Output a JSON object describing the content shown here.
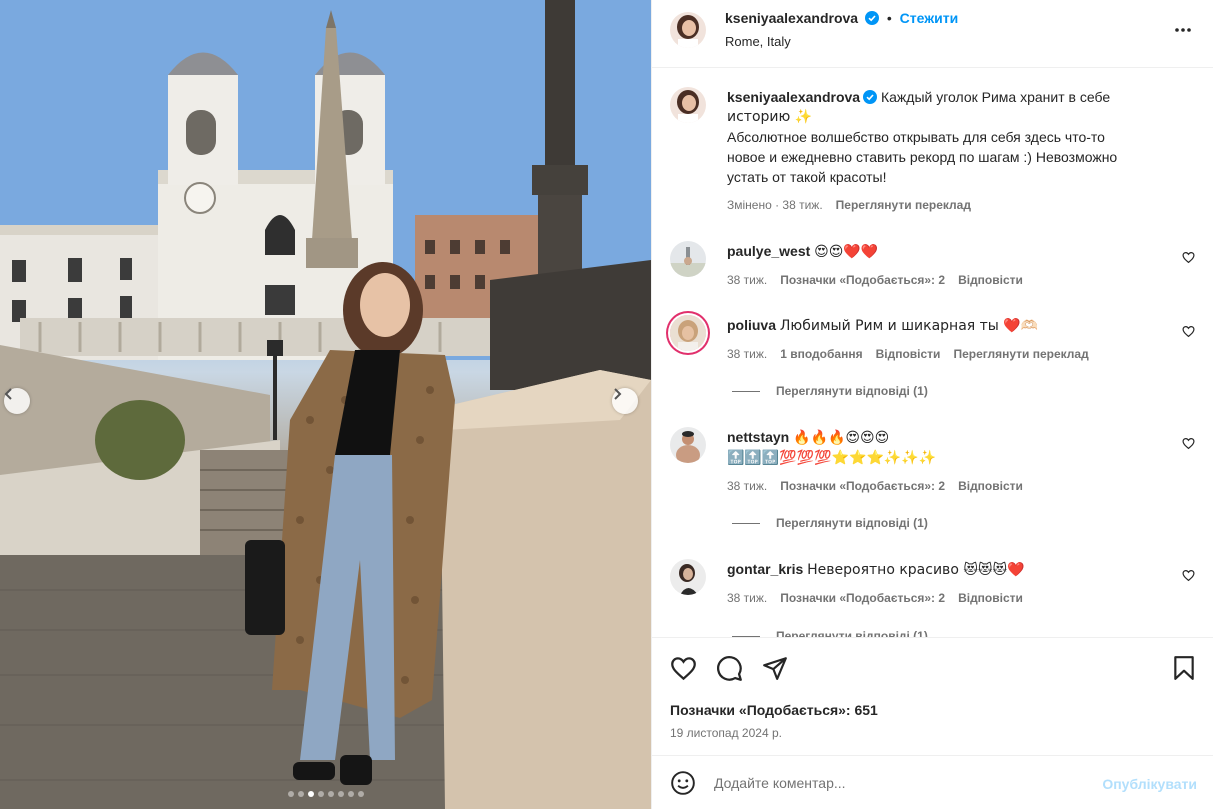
{
  "post": {
    "author": "kseniyaalexandrova",
    "follow_label": "Стежити",
    "location": "Rome, Italy",
    "caption_line1": "Каждый уголок Рима хранит в себе",
    "caption_line2": "историю ✨",
    "caption_line3": "Абсолютное волшебство открывать для себя здесь что-то",
    "caption_line4": "новое и ежедневно ставить рекорд по шагам :) Невозможно",
    "caption_line5": "устать от такой красоты!",
    "caption_edited": "Змінено · 38 тиж.",
    "caption_translate": "Переглянути переклад",
    "likes_text": "Позначки «Подобається»: 651",
    "date": "19 листопад 2024 р.",
    "carousel_count": 8,
    "carousel_active_index": 2
  },
  "comments": [
    {
      "user": "paulye_west",
      "text": "😍😍❤️❤️",
      "age": "38 тиж.",
      "likes": "Позначки «Подобається»: 2",
      "reply": "Відповісти"
    },
    {
      "user": "poliuva",
      "text": "Любимый Рим и шикарная ты ❤️🫶🏻",
      "age": "38 тиж.",
      "likes": "1 вподобання",
      "reply": "Відповісти",
      "translate": "Переглянути переклад",
      "view_replies": "Переглянути відповіді (1)"
    },
    {
      "user": "nettstayn",
      "text": "🔥🔥🔥😍😍😍",
      "text2": "🔝🔝🔝💯💯💯⭐⭐⭐✨✨✨",
      "age": "38 тиж.",
      "likes": "Позначки «Подобається»: 2",
      "reply": "Відповісти",
      "view_replies": "Переглянути відповіді (1)"
    },
    {
      "user": "gontar_kris",
      "text": "Невероятно красиво 😻😻😻❤️",
      "age": "38 тиж.",
      "likes": "Позначки «Подобається»: 2",
      "reply": "Відповісти",
      "view_replies": "Переглянути відповіді (1)"
    }
  ],
  "composer": {
    "placeholder": "Додайте коментар...",
    "publish_label": "Опублікувати"
  },
  "icons": {
    "more": "more-horizontal-icon",
    "like": "heart-icon",
    "comment": "comment-icon",
    "share": "send-icon",
    "save": "bookmark-icon",
    "emoji": "emoji-icon",
    "verified": "verified-badge-icon",
    "prev": "chevron-left-icon",
    "next": "chevron-right-icon"
  },
  "colors": {
    "accent": "#0095f6",
    "verified": "#0095f6",
    "muted": "#737373",
    "publish_disabled": "#b2dffc"
  }
}
